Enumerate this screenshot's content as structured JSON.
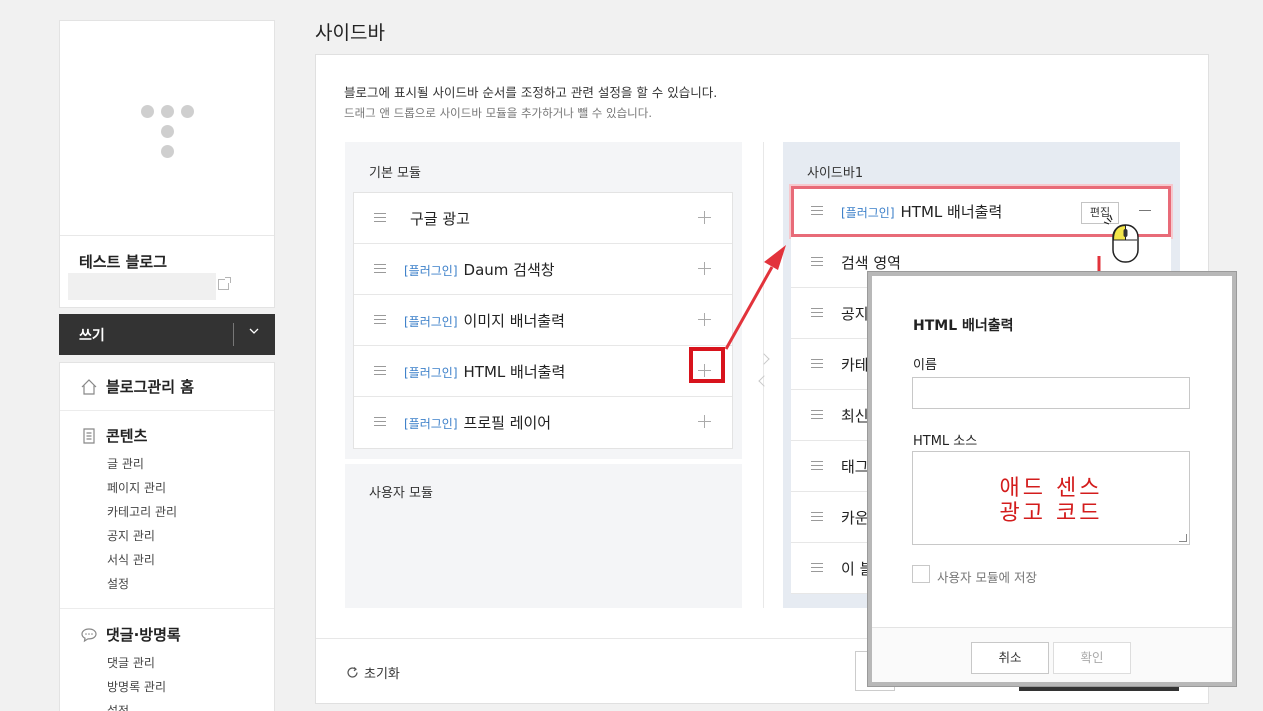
{
  "sidebar": {
    "blog_name": "테스트 블로그",
    "write_label": "쓰기",
    "home_label": "블로그관리 홈",
    "contents": {
      "label": "콘텐츠",
      "items": [
        "글 관리",
        "페이지 관리",
        "카테고리 관리",
        "공지 관리",
        "서식 관리",
        "설정"
      ]
    },
    "comments": {
      "label": "댓글·방명록",
      "items": [
        "댓글 관리",
        "방명록 관리",
        "설정"
      ]
    }
  },
  "main": {
    "title": "사이드바",
    "desc1": "블로그에 표시될 사이드바 순서를 조정하고 관련 설정을 할 수 있습니다.",
    "desc2": "드래그 앤 드롭으로 사이드바 모듈을 추가하거나 뺄 수 있습니다.",
    "basic_title": "기본 모듈",
    "basic_modules": [
      {
        "tag": "",
        "label": "구글 광고"
      },
      {
        "tag": "[플러그인]",
        "label": "Daum 검색창"
      },
      {
        "tag": "[플러그인]",
        "label": "이미지 배너출력"
      },
      {
        "tag": "[플러그인]",
        "label": "HTML 배너출력"
      },
      {
        "tag": "[플러그인]",
        "label": "프로필 레이어"
      }
    ],
    "user_title": "사용자 모듈",
    "side_title": "사이드바1",
    "side_modules": [
      {
        "tag": "[플러그인]",
        "label": "HTML 배너출력"
      },
      {
        "tag": "",
        "label": "검색 영역"
      },
      {
        "tag": "",
        "label": "공지"
      },
      {
        "tag": "",
        "label": "카테"
      },
      {
        "tag": "",
        "label": "최신"
      },
      {
        "tag": "",
        "label": "태그"
      },
      {
        "tag": "",
        "label": "카운"
      },
      {
        "tag": "",
        "label": "이 블"
      }
    ],
    "edit_label": "편집",
    "reset_label": "초기화"
  },
  "modal": {
    "title": "HTML 배너출력",
    "name_label": "이름",
    "name_value": "",
    "source_label": "HTML 소스",
    "source_line1": "애드 센스",
    "source_line2": "광고 코드",
    "save_label": "사용자 모듈에 저장",
    "cancel_label": "취소",
    "ok_label": "확인"
  },
  "colors": {
    "highlight_red": "#d8131c",
    "plugin_tag": "#3b7fc9",
    "dark_button": "#333333"
  }
}
